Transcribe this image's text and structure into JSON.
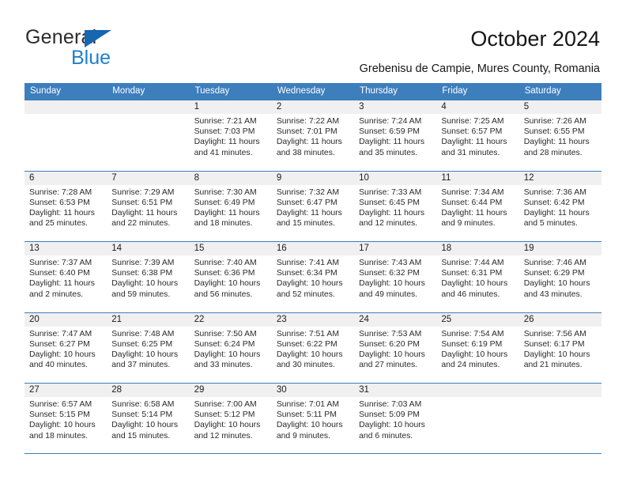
{
  "brand": {
    "name_top": "General",
    "name_bottom": "Blue",
    "accent_color": "#1666b0",
    "blue_text_color": "#1f7fd0"
  },
  "header": {
    "title": "October 2024",
    "subtitle": "Grebenisu de Campie, Mures County, Romania"
  },
  "calendar": {
    "header_bg": "#3d7ebd",
    "daynum_strip_bg": "#f0f0f0",
    "weekday_headers": [
      "Sunday",
      "Monday",
      "Tuesday",
      "Wednesday",
      "Thursday",
      "Friday",
      "Saturday"
    ],
    "weeks": [
      [
        {
          "day": "",
          "sunrise": "",
          "sunset": "",
          "daylight": "",
          "daylight2": "",
          "empty": true
        },
        {
          "day": "",
          "sunrise": "",
          "sunset": "",
          "daylight": "",
          "daylight2": "",
          "empty": true
        },
        {
          "day": "1",
          "sunrise": "Sunrise: 7:21 AM",
          "sunset": "Sunset: 7:03 PM",
          "daylight": "Daylight: 11 hours",
          "daylight2": "and 41 minutes."
        },
        {
          "day": "2",
          "sunrise": "Sunrise: 7:22 AM",
          "sunset": "Sunset: 7:01 PM",
          "daylight": "Daylight: 11 hours",
          "daylight2": "and 38 minutes."
        },
        {
          "day": "3",
          "sunrise": "Sunrise: 7:24 AM",
          "sunset": "Sunset: 6:59 PM",
          "daylight": "Daylight: 11 hours",
          "daylight2": "and 35 minutes."
        },
        {
          "day": "4",
          "sunrise": "Sunrise: 7:25 AM",
          "sunset": "Sunset: 6:57 PM",
          "daylight": "Daylight: 11 hours",
          "daylight2": "and 31 minutes."
        },
        {
          "day": "5",
          "sunrise": "Sunrise: 7:26 AM",
          "sunset": "Sunset: 6:55 PM",
          "daylight": "Daylight: 11 hours",
          "daylight2": "and 28 minutes."
        }
      ],
      [
        {
          "day": "6",
          "sunrise": "Sunrise: 7:28 AM",
          "sunset": "Sunset: 6:53 PM",
          "daylight": "Daylight: 11 hours",
          "daylight2": "and 25 minutes."
        },
        {
          "day": "7",
          "sunrise": "Sunrise: 7:29 AM",
          "sunset": "Sunset: 6:51 PM",
          "daylight": "Daylight: 11 hours",
          "daylight2": "and 22 minutes."
        },
        {
          "day": "8",
          "sunrise": "Sunrise: 7:30 AM",
          "sunset": "Sunset: 6:49 PM",
          "daylight": "Daylight: 11 hours",
          "daylight2": "and 18 minutes."
        },
        {
          "day": "9",
          "sunrise": "Sunrise: 7:32 AM",
          "sunset": "Sunset: 6:47 PM",
          "daylight": "Daylight: 11 hours",
          "daylight2": "and 15 minutes."
        },
        {
          "day": "10",
          "sunrise": "Sunrise: 7:33 AM",
          "sunset": "Sunset: 6:45 PM",
          "daylight": "Daylight: 11 hours",
          "daylight2": "and 12 minutes."
        },
        {
          "day": "11",
          "sunrise": "Sunrise: 7:34 AM",
          "sunset": "Sunset: 6:44 PM",
          "daylight": "Daylight: 11 hours",
          "daylight2": "and 9 minutes."
        },
        {
          "day": "12",
          "sunrise": "Sunrise: 7:36 AM",
          "sunset": "Sunset: 6:42 PM",
          "daylight": "Daylight: 11 hours",
          "daylight2": "and 5 minutes."
        }
      ],
      [
        {
          "day": "13",
          "sunrise": "Sunrise: 7:37 AM",
          "sunset": "Sunset: 6:40 PM",
          "daylight": "Daylight: 11 hours",
          "daylight2": "and 2 minutes."
        },
        {
          "day": "14",
          "sunrise": "Sunrise: 7:39 AM",
          "sunset": "Sunset: 6:38 PM",
          "daylight": "Daylight: 10 hours",
          "daylight2": "and 59 minutes."
        },
        {
          "day": "15",
          "sunrise": "Sunrise: 7:40 AM",
          "sunset": "Sunset: 6:36 PM",
          "daylight": "Daylight: 10 hours",
          "daylight2": "and 56 minutes."
        },
        {
          "day": "16",
          "sunrise": "Sunrise: 7:41 AM",
          "sunset": "Sunset: 6:34 PM",
          "daylight": "Daylight: 10 hours",
          "daylight2": "and 52 minutes."
        },
        {
          "day": "17",
          "sunrise": "Sunrise: 7:43 AM",
          "sunset": "Sunset: 6:32 PM",
          "daylight": "Daylight: 10 hours",
          "daylight2": "and 49 minutes."
        },
        {
          "day": "18",
          "sunrise": "Sunrise: 7:44 AM",
          "sunset": "Sunset: 6:31 PM",
          "daylight": "Daylight: 10 hours",
          "daylight2": "and 46 minutes."
        },
        {
          "day": "19",
          "sunrise": "Sunrise: 7:46 AM",
          "sunset": "Sunset: 6:29 PM",
          "daylight": "Daylight: 10 hours",
          "daylight2": "and 43 minutes."
        }
      ],
      [
        {
          "day": "20",
          "sunrise": "Sunrise: 7:47 AM",
          "sunset": "Sunset: 6:27 PM",
          "daylight": "Daylight: 10 hours",
          "daylight2": "and 40 minutes."
        },
        {
          "day": "21",
          "sunrise": "Sunrise: 7:48 AM",
          "sunset": "Sunset: 6:25 PM",
          "daylight": "Daylight: 10 hours",
          "daylight2": "and 37 minutes."
        },
        {
          "day": "22",
          "sunrise": "Sunrise: 7:50 AM",
          "sunset": "Sunset: 6:24 PM",
          "daylight": "Daylight: 10 hours",
          "daylight2": "and 33 minutes."
        },
        {
          "day": "23",
          "sunrise": "Sunrise: 7:51 AM",
          "sunset": "Sunset: 6:22 PM",
          "daylight": "Daylight: 10 hours",
          "daylight2": "and 30 minutes."
        },
        {
          "day": "24",
          "sunrise": "Sunrise: 7:53 AM",
          "sunset": "Sunset: 6:20 PM",
          "daylight": "Daylight: 10 hours",
          "daylight2": "and 27 minutes."
        },
        {
          "day": "25",
          "sunrise": "Sunrise: 7:54 AM",
          "sunset": "Sunset: 6:19 PM",
          "daylight": "Daylight: 10 hours",
          "daylight2": "and 24 minutes."
        },
        {
          "day": "26",
          "sunrise": "Sunrise: 7:56 AM",
          "sunset": "Sunset: 6:17 PM",
          "daylight": "Daylight: 10 hours",
          "daylight2": "and 21 minutes."
        }
      ],
      [
        {
          "day": "27",
          "sunrise": "Sunrise: 6:57 AM",
          "sunset": "Sunset: 5:15 PM",
          "daylight": "Daylight: 10 hours",
          "daylight2": "and 18 minutes."
        },
        {
          "day": "28",
          "sunrise": "Sunrise: 6:58 AM",
          "sunset": "Sunset: 5:14 PM",
          "daylight": "Daylight: 10 hours",
          "daylight2": "and 15 minutes."
        },
        {
          "day": "29",
          "sunrise": "Sunrise: 7:00 AM",
          "sunset": "Sunset: 5:12 PM",
          "daylight": "Daylight: 10 hours",
          "daylight2": "and 12 minutes."
        },
        {
          "day": "30",
          "sunrise": "Sunrise: 7:01 AM",
          "sunset": "Sunset: 5:11 PM",
          "daylight": "Daylight: 10 hours",
          "daylight2": "and 9 minutes."
        },
        {
          "day": "31",
          "sunrise": "Sunrise: 7:03 AM",
          "sunset": "Sunset: 5:09 PM",
          "daylight": "Daylight: 10 hours",
          "daylight2": "and 6 minutes."
        },
        {
          "day": "",
          "sunrise": "",
          "sunset": "",
          "daylight": "",
          "daylight2": "",
          "empty": true
        },
        {
          "day": "",
          "sunrise": "",
          "sunset": "",
          "daylight": "",
          "daylight2": "",
          "empty": true
        }
      ]
    ]
  }
}
